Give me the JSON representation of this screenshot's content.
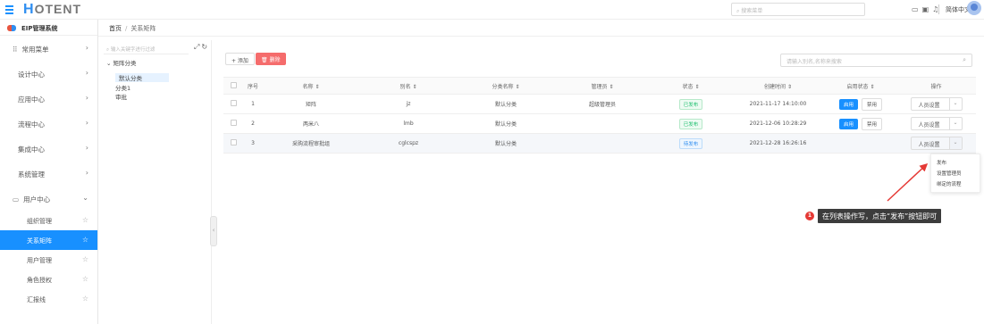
{
  "topbar": {
    "logo_first": "H",
    "logo_rest": "OTENT",
    "search_placeholder": "搜索菜单",
    "icons": [
      "fullscreen-icon",
      "screen-icon",
      "bell-icon"
    ],
    "language": "简体中文"
  },
  "sidebar": {
    "system_title": "EIP管理系统",
    "menu": [
      {
        "label": "常用菜单"
      },
      {
        "label": "设计中心"
      },
      {
        "label": "应用中心"
      },
      {
        "label": "流程中心"
      },
      {
        "label": "集成中心"
      },
      {
        "label": "系统管理"
      },
      {
        "label": "用户中心"
      }
    ],
    "submenu": [
      {
        "label": "组织管理"
      },
      {
        "label": "关系矩阵"
      },
      {
        "label": "用户管理"
      },
      {
        "label": "角色授权"
      },
      {
        "label": "汇报线"
      }
    ]
  },
  "breadcrumb": {
    "home": "首页",
    "current": "关系矩阵"
  },
  "tree": {
    "search_placeholder": "输入关键字进行过滤",
    "root": "矩阵分类",
    "nodes": [
      "默认分类",
      "分类1",
      "审批"
    ]
  },
  "toolbar": {
    "add_label": "+ 添加",
    "delete_label": "删除",
    "search_placeholder": "请输入别名,名称来搜索"
  },
  "table": {
    "headers": [
      "序号",
      "名称 ⇕",
      "别名 ⇕",
      "分类名称 ⇕",
      "管理员 ⇕",
      "状态 ⇕",
      "创建时间 ⇕",
      "启用状态 ⇕",
      "操作"
    ],
    "rows": [
      {
        "index": "1",
        "name": "矩阵",
        "alias": "jz",
        "category": "默认分类",
        "admin": "超级管理员",
        "status": "已发布",
        "created": "2021-11-17 14:10:00",
        "enable": "启用",
        "disable": "禁用",
        "op": "人员设置"
      },
      {
        "index": "2",
        "name": "两米八",
        "alias": "lmb",
        "category": "默认分类",
        "admin": "",
        "status": "已发布",
        "created": "2021-12-06 10:28:29",
        "enable": "启用",
        "disable": "禁用",
        "op": "人员设置"
      },
      {
        "index": "3",
        "name": "采购流程审批组",
        "alias": "cglcspz",
        "category": "默认分类",
        "admin": "",
        "status": "待发布",
        "created": "2021-12-28 16:26:16",
        "enable": "",
        "disable": "",
        "op": "人员设置"
      }
    ]
  },
  "dropdown_menu": [
    "发布",
    "设置管理员",
    "绑定的流程"
  ],
  "callout": {
    "number": "1",
    "text": "在列表操作写，点击“发布”按钮即可"
  },
  "colors": {
    "primary": "#1890ff",
    "danger": "#f56c6c",
    "published": "#19be6b",
    "draft": "#2d8cf0",
    "annotation": "#e53935"
  }
}
